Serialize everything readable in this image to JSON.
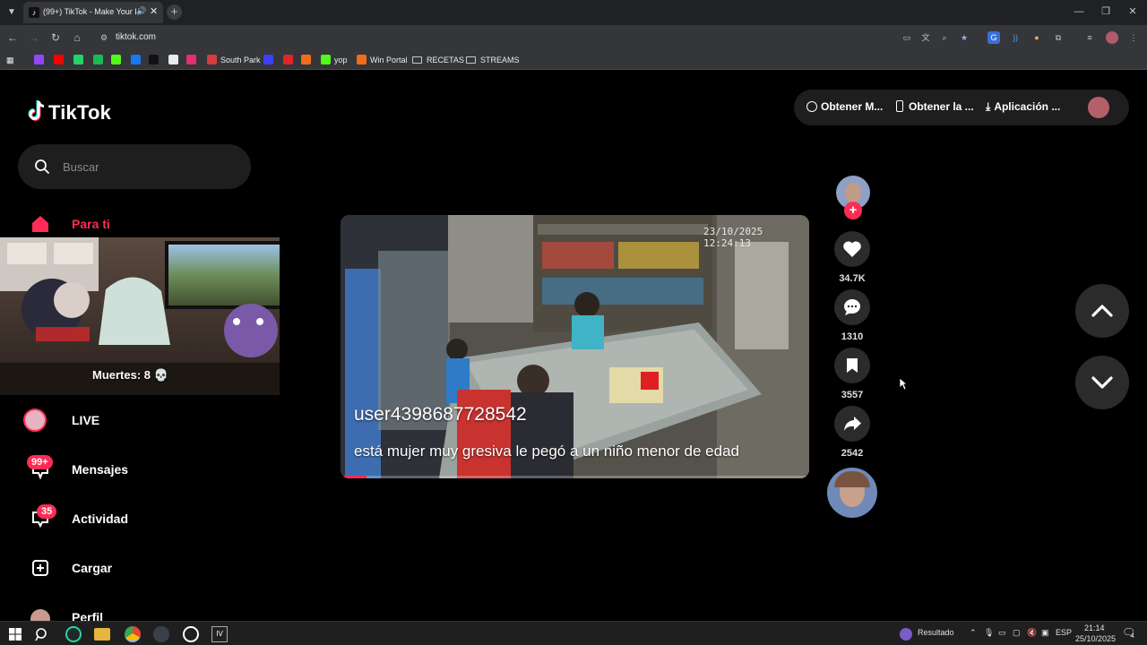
{
  "browser": {
    "tab_title": "(99+) TikTok - Make Your Day",
    "address": "tiktok.com",
    "bookmarks": [
      {
        "label": "",
        "color": "#9146ff"
      },
      {
        "label": "",
        "color": "#ff0000"
      },
      {
        "label": "",
        "color": "#25d366"
      },
      {
        "label": "",
        "color": "#1db954"
      },
      {
        "label": "",
        "color": "#53fc18"
      },
      {
        "label": "",
        "color": "#1877f2"
      },
      {
        "label": "",
        "color": "#111111"
      },
      {
        "label": "",
        "color": "#e8eaed"
      },
      {
        "label": "",
        "color": "#e1306c"
      },
      {
        "label": "South Park",
        "color": "#d63c3c"
      },
      {
        "label": "",
        "color": "#3f3ff5"
      },
      {
        "label": "",
        "color": "#e0262b"
      },
      {
        "label": "",
        "color": "#f26b1d"
      },
      {
        "label": "yop",
        "color": "#53fc18"
      },
      {
        "label": "Win Portal",
        "color": "#f26b1d"
      },
      {
        "label": "RECETAS",
        "color": "folder"
      },
      {
        "label": "STREAMS",
        "color": "folder"
      }
    ]
  },
  "tiktok": {
    "logo_text": "TikTok",
    "search_placeholder": "Buscar",
    "nav": {
      "for_you": "Para ti",
      "live": "LIVE",
      "messages": "Mensajes",
      "messages_badge": "99+",
      "activity": "Actividad",
      "activity_badge": "35",
      "upload": "Cargar",
      "profile": "Perfil"
    },
    "header": {
      "get_coins": "Obtener M...",
      "get_app": "Obtener la ...",
      "download_app": "Aplicación ..."
    },
    "video": {
      "author": "user4398687728542",
      "caption": "está mujer muy gresiva le pegó a un niño menor de edad",
      "timestamp": "23/10/2025 12:24:13",
      "progress": 0.055
    },
    "actions": {
      "likes": "34.7K",
      "comments": "1310",
      "saves": "3557",
      "shares": "2542"
    },
    "overlay": {
      "deaths_label": "Muertes: 8 💀"
    },
    "accent_color": "#fe2c55"
  },
  "taskbar": {
    "search_result": "Resultado",
    "language": "ESP",
    "time": "21:14",
    "date": "25/10/2025",
    "notification_count": "4"
  }
}
